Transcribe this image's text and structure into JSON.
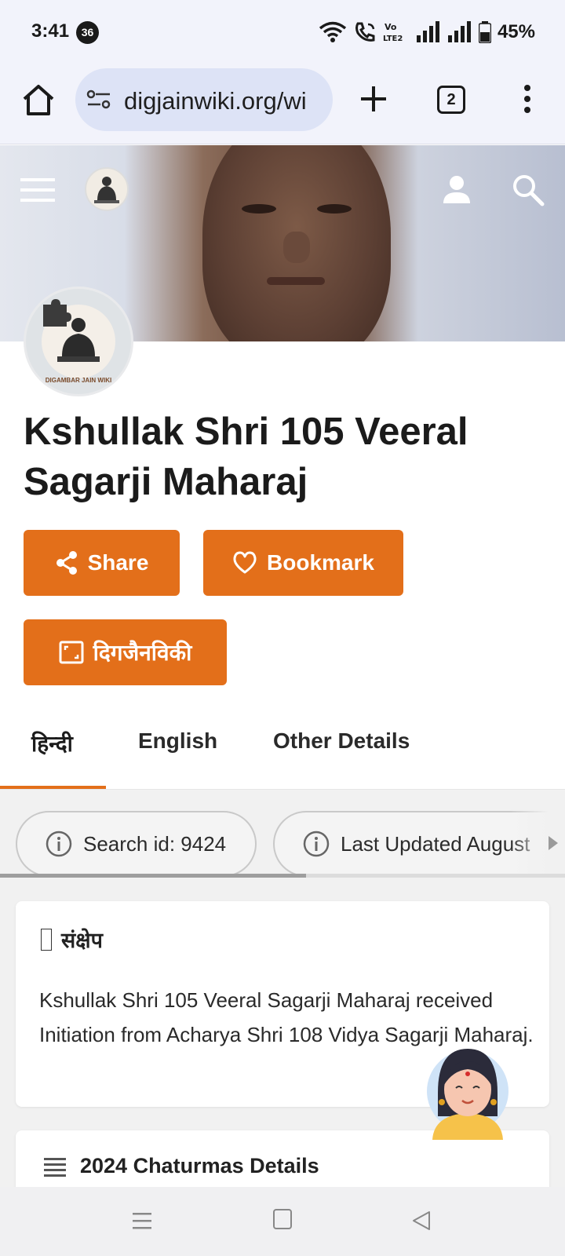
{
  "status_bar": {
    "time": "3:41",
    "notification_count": "36",
    "battery": "45%",
    "network_label": "Vo LTE2"
  },
  "browser": {
    "url": "digjainwiki.org/wi",
    "tab_count": "2"
  },
  "page": {
    "title": "Kshullak Shri 105 Veeral Sagarji Maharaj",
    "logo_caption": "DIGAMBAR JAIN WIKI"
  },
  "actions": {
    "share_label": "Share",
    "bookmark_label": "Bookmark",
    "digjain_label": "दिगजैनविकी"
  },
  "tabs": [
    {
      "label": "हिन्दी",
      "active": true
    },
    {
      "label": "English",
      "active": false
    },
    {
      "label": "Other Details",
      "active": false
    }
  ],
  "chips": {
    "search_id": "Search id: 9424",
    "last_updated": "Last Updated August"
  },
  "summary": {
    "heading": "संक्षेप",
    "body": "Kshullak Shri 105 Veeral Sagarji Maharaj received Initiation from Acharya Shri 108 Vidya Sagarji Maharaj."
  },
  "chaturmas": {
    "heading": "2024 Chaturmas Details"
  },
  "colors": {
    "accent": "#e36f1a",
    "status_bg": "#f2f3fb",
    "url_pill": "#dde3f6"
  }
}
